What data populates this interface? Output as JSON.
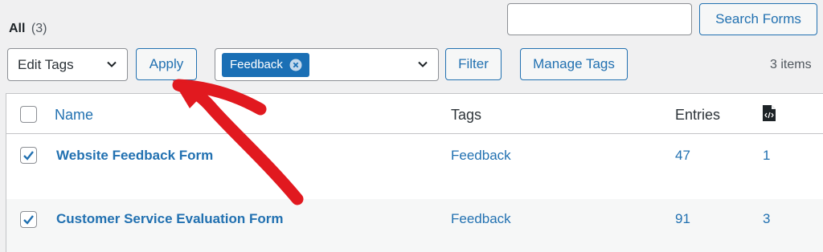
{
  "filters": {
    "all_label": "All",
    "all_count": "(3)"
  },
  "search": {
    "value": "",
    "placeholder": "",
    "button_label": "Search Forms"
  },
  "bulk_actions": {
    "selected": "Edit Tags",
    "apply_label": "Apply"
  },
  "tag_filter": {
    "selected_tag": "Feedback",
    "filter_label": "Filter",
    "manage_label": "Manage Tags"
  },
  "items_count": "3 items",
  "table": {
    "columns": {
      "name": "Name",
      "tags": "Tags",
      "entries": "Entries",
      "export_icon": "file-code-icon"
    },
    "rows": [
      {
        "name": "Website Feedback Form",
        "tags": "Feedback",
        "entries": "47",
        "count": "1",
        "checked": true
      },
      {
        "name": "Customer Service Evaluation Form",
        "tags": "Feedback",
        "entries": "91",
        "count": "3",
        "checked": true
      }
    ]
  },
  "annotation": {
    "color": "#e1191f",
    "icon": "curved-arrow-icon"
  },
  "colors": {
    "accent": "#2271b1",
    "tag_chip": "#1a6fb5"
  }
}
